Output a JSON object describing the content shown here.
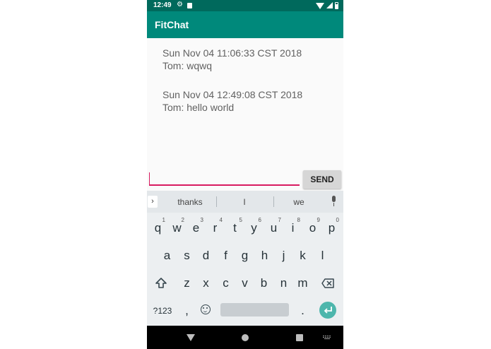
{
  "status_bar": {
    "time": "12:49"
  },
  "app_bar": {
    "title": "FitChat"
  },
  "messages": [
    {
      "timestamp": "Sun Nov 04 11:06:33 CST 2018",
      "text": "Tom: wqwq"
    },
    {
      "timestamp": "Sun Nov 04 12:49:08 CST 2018",
      "text": "Tom: hello world"
    }
  ],
  "composer": {
    "value": "",
    "send_label": "SEND"
  },
  "keyboard": {
    "suggestions": [
      "thanks",
      "I",
      "we"
    ],
    "row1": [
      {
        "ch": "q",
        "num": "1"
      },
      {
        "ch": "w",
        "num": "2"
      },
      {
        "ch": "e",
        "num": "3"
      },
      {
        "ch": "r",
        "num": "4"
      },
      {
        "ch": "t",
        "num": "5"
      },
      {
        "ch": "y",
        "num": "6"
      },
      {
        "ch": "u",
        "num": "7"
      },
      {
        "ch": "i",
        "num": "8"
      },
      {
        "ch": "o",
        "num": "9"
      },
      {
        "ch": "p",
        "num": "0"
      }
    ],
    "row2": [
      "a",
      "s",
      "d",
      "f",
      "g",
      "h",
      "j",
      "k",
      "l"
    ],
    "row3": [
      "z",
      "x",
      "c",
      "v",
      "b",
      "n",
      "m"
    ],
    "symbols_label": "?123",
    "comma": ",",
    "period": "."
  },
  "colors": {
    "status_bar": "#00695c",
    "app_bar": "#00897b",
    "accent": "#d81b60",
    "enter_key": "#4db6ac"
  }
}
